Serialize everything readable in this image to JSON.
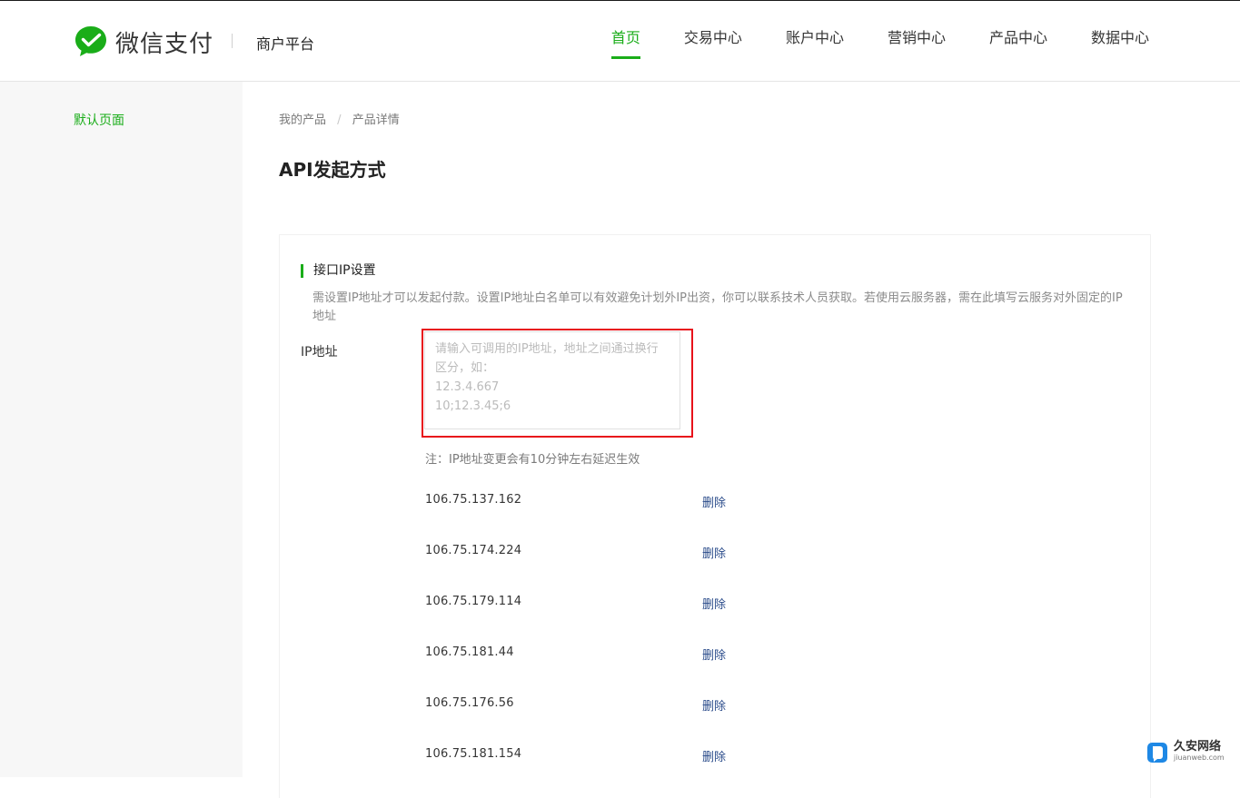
{
  "header": {
    "brand": "微信支付",
    "platform": "商户平台",
    "nav": [
      {
        "label": "首页",
        "active": true
      },
      {
        "label": "交易中心",
        "active": false
      },
      {
        "label": "账户中心",
        "active": false
      },
      {
        "label": "营销中心",
        "active": false
      },
      {
        "label": "产品中心",
        "active": false
      },
      {
        "label": "数据中心",
        "active": false
      }
    ]
  },
  "sidebar": {
    "items": [
      {
        "label": "默认页面"
      }
    ]
  },
  "breadcrumb": [
    "我的产品",
    "产品详情"
  ],
  "page_title": "API发起方式",
  "section": {
    "title": "接口IP设置",
    "description": "需设置IP地址才可以发起付款。设置IP地址白名单可以有效避免计划外IP出资，你可以联系技术人员获取。若使用云服务器，需在此填写云服务对外固定的IP地址",
    "ip_label": "IP地址",
    "textarea": {
      "value": "",
      "placeholder": "请输入可调用的IP地址，地址之间通过换行区分，如：\n12.3.4.667\n10;12.3.45;6"
    },
    "note": "注：IP地址变更会有10分钟左右延迟生效",
    "delete_label": "删除",
    "ips": [
      "106.75.137.162",
      "106.75.174.224",
      "106.75.179.114",
      "106.75.181.44",
      "106.75.176.56",
      "106.75.181.154"
    ]
  },
  "watermark": {
    "name": "久安网络",
    "domain": "jiuanweb.com"
  },
  "colors": {
    "brand_green": "#1aad19",
    "highlight_red": "#e8121b",
    "link_blue": "#2a4b8a"
  }
}
